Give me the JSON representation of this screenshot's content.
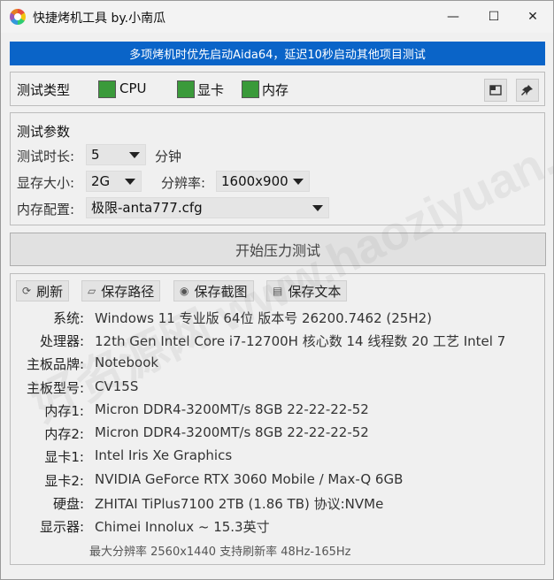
{
  "window": {
    "title": "快捷烤机工具 by.小南瓜",
    "minimize_glyph": "—",
    "maximize_glyph": "☐",
    "close_glyph": "✕"
  },
  "banner": {
    "text": "多项烤机时优先启动Aida64，延迟10秒启动其他项目测试",
    "color": "#0a64c8"
  },
  "test_type": {
    "label": "测试类型",
    "options": [
      {
        "label": "CPU",
        "checked": true
      },
      {
        "label": "显卡",
        "checked": true
      },
      {
        "label": "内存",
        "checked": true
      }
    ],
    "checkbox_color": "#3a9a3a",
    "icons": [
      "window-icon",
      "pin-icon"
    ]
  },
  "params": {
    "title": "测试参数",
    "duration_label": "测试时长:",
    "duration_value": "5",
    "duration_unit": "分钟",
    "vram_label": "显存大小:",
    "vram_value": "2G",
    "resolution_label": "分辨率:",
    "resolution_value": "1600x900",
    "memory_label": "内存配置:",
    "memory_value": "极限-anta777.cfg"
  },
  "start_button": "开始压力测试",
  "toolbar": {
    "refresh": "刷新",
    "save_path": "保存路径",
    "save_screenshot": "保存截图",
    "save_text": "保存文本"
  },
  "info": [
    {
      "label": "系统:",
      "value": "Windows 11 专业版 64位 版本号 26200.7462 (25H2)"
    },
    {
      "label": "处理器:",
      "value": "12th Gen Intel Core i7-12700H 核心数 14 线程数 20 工艺 Intel 7"
    },
    {
      "label": "主板品牌:",
      "value": "Notebook"
    },
    {
      "label": "主板型号:",
      "value": "CV15S"
    },
    {
      "label": "内存1:",
      "value": "Micron DDR4-3200MT/s 8GB 22-22-22-52"
    },
    {
      "label": "内存2:",
      "value": "Micron DDR4-3200MT/s 8GB 22-22-22-52"
    },
    {
      "label": "显卡1:",
      "value": "Intel Iris Xe Graphics"
    },
    {
      "label": "显卡2:",
      "value": "NVIDIA GeForce RTX 3060 Mobile / Max-Q 6GB"
    },
    {
      "label": "硬盘:",
      "value": "ZHITAI TiPlus7100 2TB (1.86 TB) 协议:NVMe"
    },
    {
      "label": "显示器:",
      "value": "Chimei Innolux ~ 15.3英寸"
    }
  ],
  "display_note": "最大分辨率 2560x1440 支持刷新率 48Hz-165Hz",
  "watermark": "好资源网 www.haoziyuan.com"
}
